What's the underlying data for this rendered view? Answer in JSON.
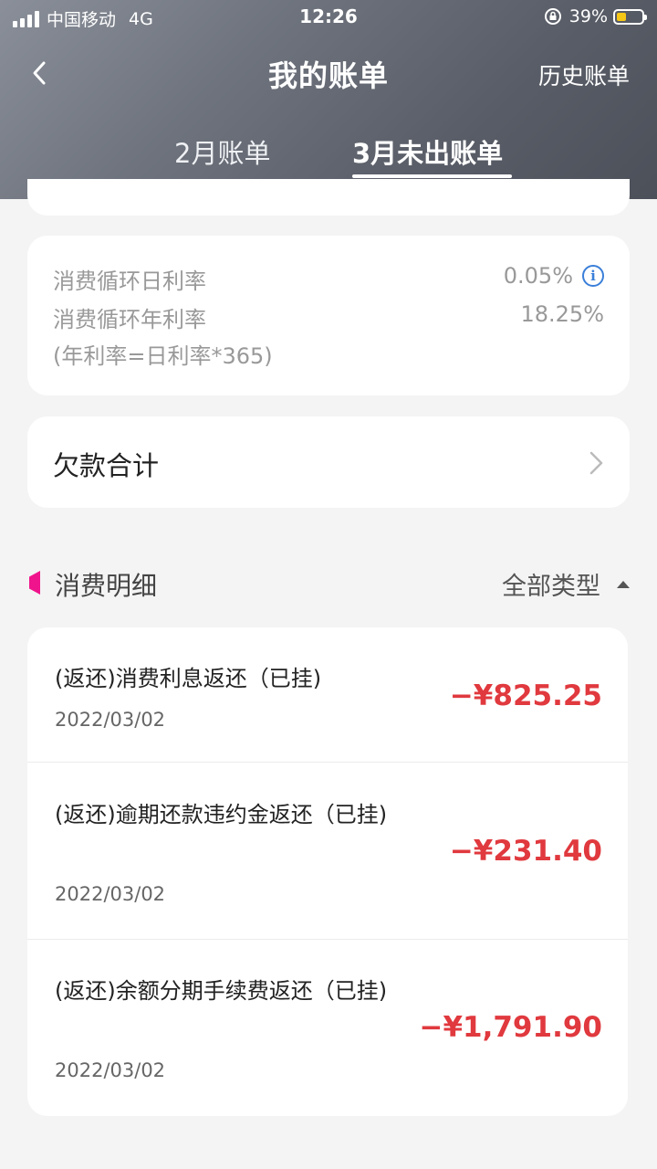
{
  "status_bar": {
    "carrier": "中国移动",
    "network": "4G",
    "time": "12:26",
    "battery_percent": "39%",
    "battery_level": 0.39
  },
  "nav": {
    "title": "我的账单",
    "history": "历史账单"
  },
  "tabs": [
    {
      "label": "2月账单",
      "active": false
    },
    {
      "label": "3月未出账单",
      "active": true
    }
  ],
  "rates": {
    "daily_label": "消费循环日利率",
    "daily_value": "0.05%",
    "annual_label": "消费循环年利率",
    "annual_value": "18.25%",
    "formula": "(年利率=日利率*365)"
  },
  "debt": {
    "label": "欠款合计"
  },
  "details": {
    "title": "消费明细",
    "filter": "全部类型",
    "accent_color": "#f0148c",
    "transactions": [
      {
        "description": "(返还)消费利息返还（已挂)",
        "date": "2022/03/02",
        "amount": "−¥825.25"
      },
      {
        "description": "(返还)逾期还款违约金返还（已挂)",
        "date": "2022/03/02",
        "amount": "−¥231.40"
      },
      {
        "description": "(返还)余额分期手续费返还（已挂)",
        "date": "2022/03/02",
        "amount": "−¥1,791.90"
      }
    ]
  },
  "colors": {
    "amount": "#e0393e",
    "info": "#3a7fd9"
  }
}
